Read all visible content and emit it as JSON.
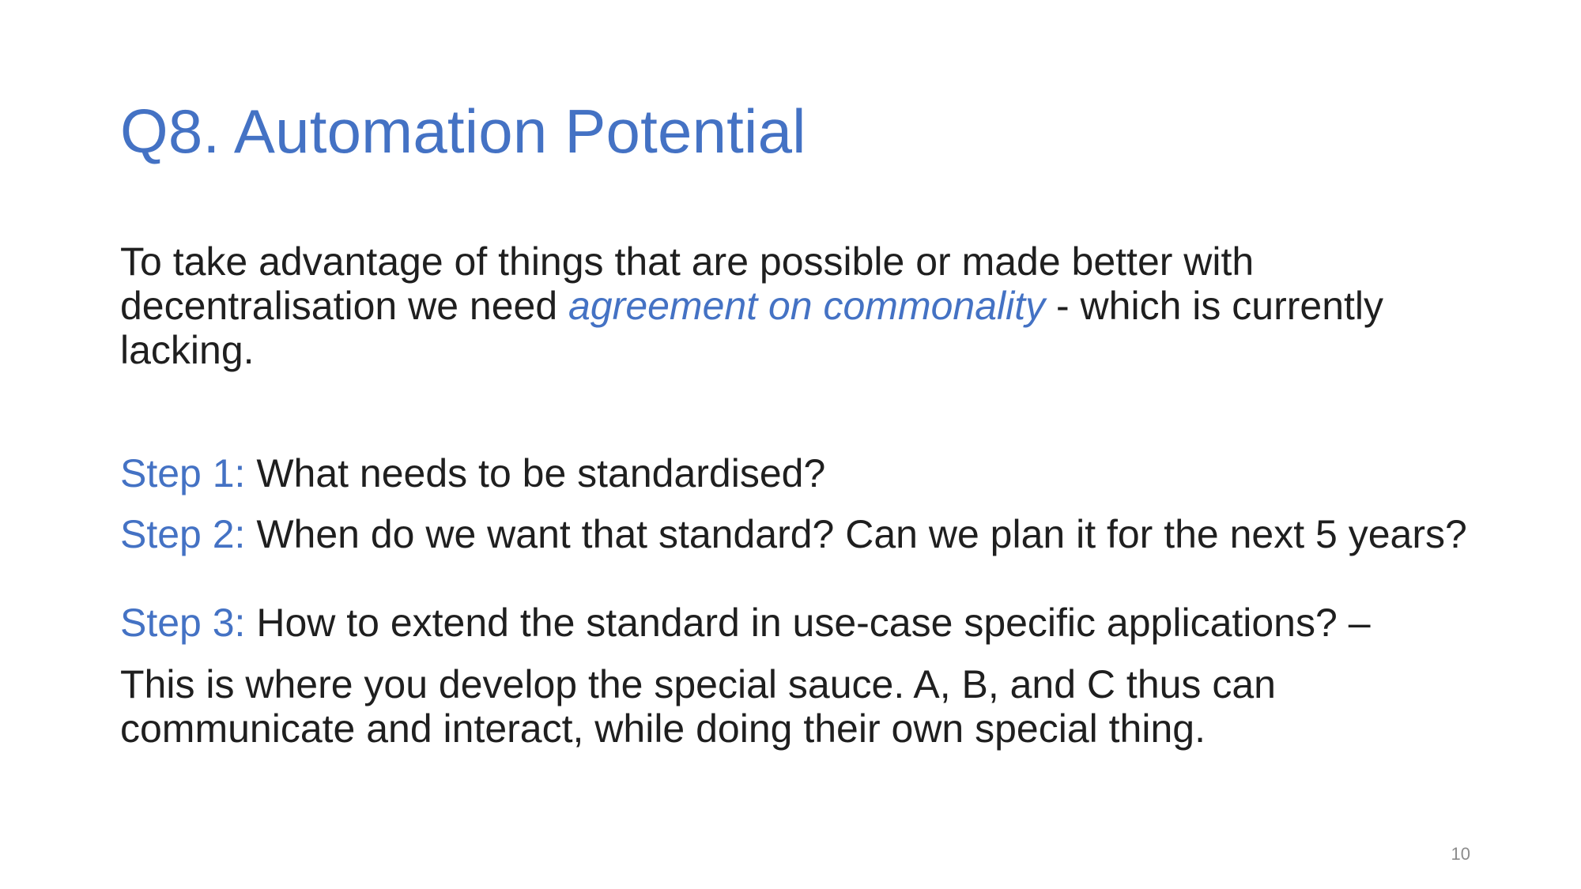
{
  "slide": {
    "title": "Q8. Automation Potential",
    "intro": {
      "before": "To take advantage of things that are possible or made better with decentralisation we need ",
      "highlight": "agreement on commonality",
      "after": " - which is currently lacking."
    },
    "steps": [
      {
        "label": "Step 1:",
        "text": " What needs to be standardised?"
      },
      {
        "label": "Step 2:",
        "text": " When do we want that standard? Can we plan it for the next 5 years?"
      },
      {
        "label": "Step 3:",
        "text": " How to extend the standard in use-case specific applications? –"
      }
    ],
    "closing": "This is where you develop the special sauce. A, B, and C thus can communicate and interact, while doing their own special thing.",
    "slide_number": "10"
  },
  "colors": {
    "accent": "#4472c4",
    "text": "#1f1f1f",
    "slide_number": "#8c8c8c",
    "background": "#ffffff"
  }
}
